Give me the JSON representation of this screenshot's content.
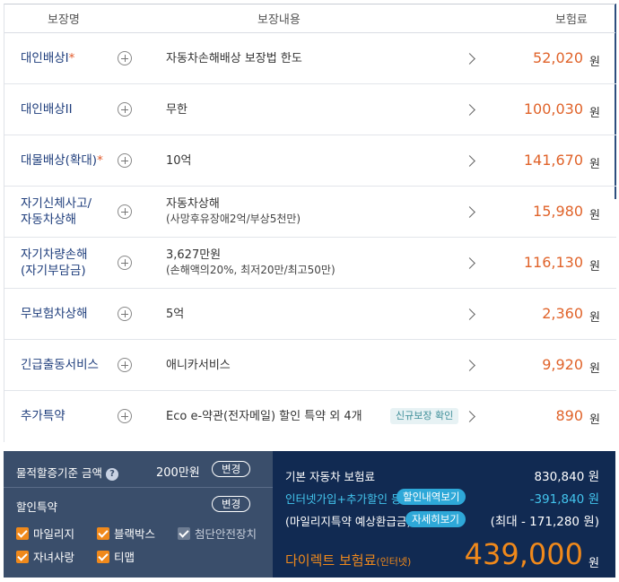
{
  "header": {
    "col_name": "보장명",
    "col_content": "보장내용",
    "col_premium": "보험료"
  },
  "rows": [
    {
      "name": "대인배상I",
      "star": "*",
      "content": "자동차손해배상 보장법 한도",
      "sub": "",
      "badge": "",
      "price": "52,020",
      "unit": "원"
    },
    {
      "name": "대인배상II",
      "star": "",
      "content": "무한",
      "sub": "",
      "badge": "",
      "price": "100,030",
      "unit": "원"
    },
    {
      "name": "대물배상(확대)",
      "star": "*",
      "content": "10억",
      "sub": "",
      "badge": "",
      "price": "141,670",
      "unit": "원"
    },
    {
      "name": "자기신체사고/",
      "name2": "자동차상해",
      "star": "",
      "content": "자동차상해",
      "sub": "(사망후유장애2억/부상5천만)",
      "badge": "",
      "price": "15,980",
      "unit": "원"
    },
    {
      "name": "자기차량손해",
      "name2": "(자기부담금)",
      "star": "",
      "content": "3,627만원",
      "sub": "(손해액의20%, 최저20만/최고50만)",
      "badge": "",
      "price": "116,130",
      "unit": "원"
    },
    {
      "name": "무보험차상해",
      "star": "",
      "content": "5억",
      "sub": "",
      "badge": "",
      "price": "2,360",
      "unit": "원"
    },
    {
      "name": "긴급출동서비스",
      "star": "",
      "content": "애니카서비스",
      "sub": "",
      "badge": "",
      "price": "9,920",
      "unit": "원"
    },
    {
      "name": "추가특약",
      "star": "",
      "content": "Eco e-약관(전자메일) 할인 특약 외 4개",
      "sub": "",
      "badge": "신규보장 확인",
      "price": "890",
      "unit": "원"
    }
  ],
  "left_panel": {
    "property_label": "물적할증기준 금액",
    "property_help": "?",
    "property_value": "200만원",
    "change_label": "변경",
    "discount_label": "할인특약",
    "change_label2": "변경",
    "options": [
      {
        "label": "마일리지",
        "checked": true
      },
      {
        "label": "블랙박스",
        "checked": true
      },
      {
        "label": "첨단안전장치",
        "checked": false
      },
      {
        "label": "자녀사랑",
        "checked": true
      },
      {
        "label": "티맵",
        "checked": true
      }
    ]
  },
  "right_panel": {
    "base_label": "기본 자동차 보험료",
    "base_value": "830,840 원",
    "discount_label": "인터넷가입+추가할인 등",
    "discount_btn": "할인내역보기",
    "discount_value": "-391,840 원",
    "mileage_label": "(마일리지특약 예상환급금)",
    "mileage_btn": "자세히보기",
    "mileage_value": "(최대 - 171,280 원)",
    "total_label": "다이렉트 보험료",
    "total_sub": "(인터넷)",
    "total_value": "439,000",
    "total_unit": "원"
  },
  "colors": {
    "accent_orange": "#e0632a",
    "navy": "#112a52",
    "slate": "#3a4e6b",
    "cyan": "#43c5ee"
  }
}
